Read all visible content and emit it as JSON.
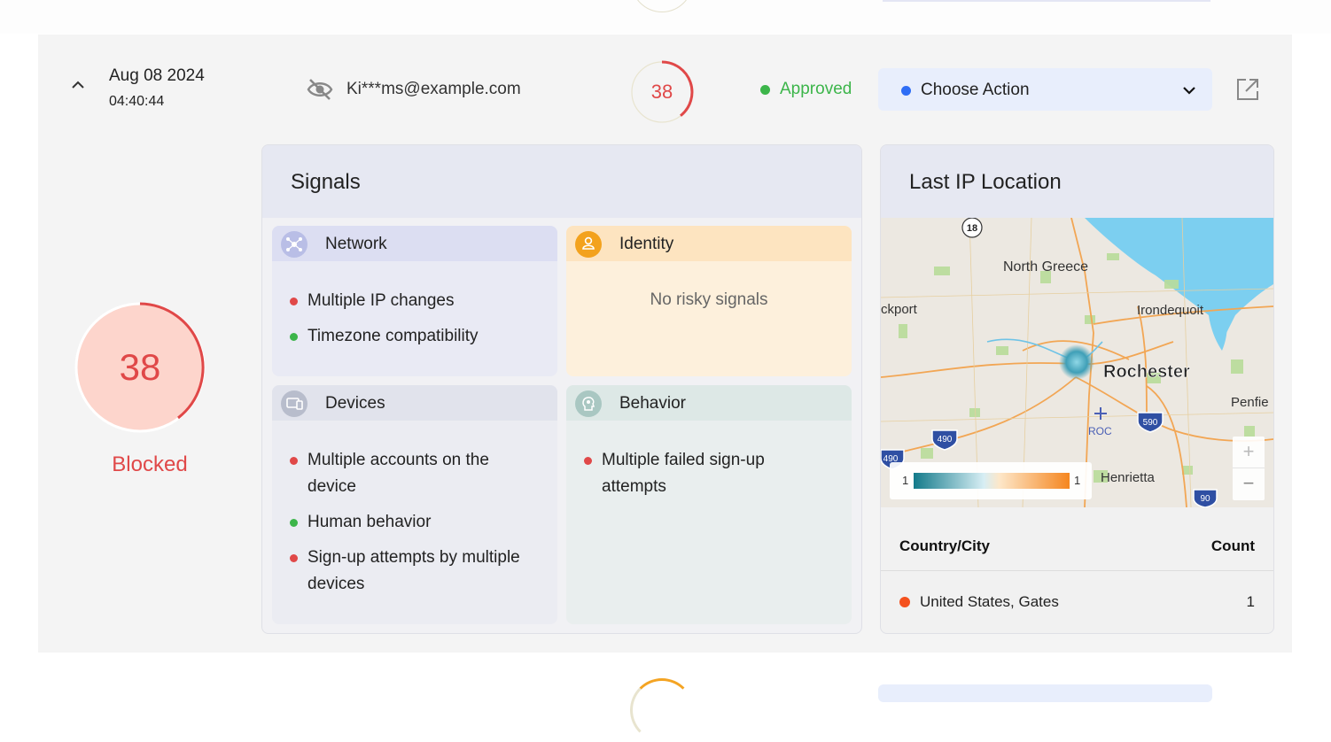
{
  "row": {
    "date": "Aug 08 2024",
    "time": "04:40:44",
    "email": "Ki***ms@example.com",
    "score": "38",
    "status": "Approved",
    "action_label": "Choose Action"
  },
  "summary": {
    "score": "38",
    "verdict": "Blocked"
  },
  "signals": {
    "title": "Signals",
    "network": {
      "title": "Network",
      "items": [
        {
          "text": "Multiple IP changes",
          "level": "risk"
        },
        {
          "text": "Timezone compatibility",
          "level": "ok"
        }
      ]
    },
    "identity": {
      "title": "Identity",
      "empty": "No risky signals"
    },
    "devices": {
      "title": "Devices",
      "items": [
        {
          "text": "Multiple accounts on the device",
          "level": "risk"
        },
        {
          "text": "Human behavior",
          "level": "ok"
        },
        {
          "text": "Sign-up attempts by multiple devices",
          "level": "risk"
        }
      ]
    },
    "behavior": {
      "title": "Behavior",
      "items": [
        {
          "text": "Multiple failed sign-up attempts",
          "level": "risk"
        }
      ]
    }
  },
  "location": {
    "title": "Last IP Location",
    "map_labels": {
      "north_greece": "North Greece",
      "brockport": "ckport",
      "irondequoit": "Irondequoit",
      "rochester": "Rochester",
      "penfield": "Penfie",
      "henrietta": "Henrietta",
      "roc": "ROC",
      "route_18": "18",
      "route_490_a": "490",
      "route_490_b": "490",
      "route_590": "590",
      "route_90": "90"
    },
    "legend_min": "1",
    "legend_max": "1",
    "zoom_in": "+",
    "zoom_out": "−",
    "table": {
      "col_place": "Country/City",
      "col_count": "Count",
      "rows": [
        {
          "place": "United States, Gates",
          "count": "1"
        }
      ]
    }
  },
  "colors": {
    "risk": "#e04848",
    "ok": "#3cb54a",
    "accent": "#2e6df5"
  }
}
